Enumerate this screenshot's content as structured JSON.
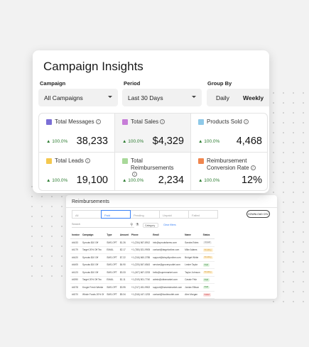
{
  "insights": {
    "title": "Campaign Insights",
    "campaign_label": "Campaign",
    "campaign_value": "All Campaigns",
    "period_label": "Period",
    "period_value": "Last 30 Days",
    "group_label": "Group By",
    "group_options": [
      "Daily",
      "Weekly"
    ],
    "group_selected": "Weekly",
    "metrics": [
      {
        "name": "Total Messages",
        "change": "▲ 100.0%",
        "value": "38,233",
        "color": "#7b6fd6"
      },
      {
        "name": "Total Sales",
        "change": "▲ 100.0%",
        "value": "$4,329",
        "color": "#c77dd8"
      },
      {
        "name": "Products Sold",
        "change": "▲ 100.0%",
        "value": "4,468",
        "color": "#8ec9e8"
      },
      {
        "name": "Total Leads",
        "change": "▲ 100.0%",
        "value": "19,100",
        "color": "#f4c84e"
      },
      {
        "name": "Total Reimbursements",
        "change": "▲ 100.0%",
        "value": "2,234",
        "color": "#a9d99a"
      },
      {
        "name": "Reimbursement Conversion Rate",
        "change": "▲ 100.0%",
        "value": "12%",
        "color": "#f0864e"
      }
    ]
  },
  "reimbursements": {
    "title": "Reimbursements",
    "filter_tabs": [
      "All",
      "Paid",
      "Pending",
      "Unpaid",
      "Failed"
    ],
    "active_tab": "Paid",
    "download_label": "DOWNLOAD CSV",
    "search_placeholder": "Search",
    "category_label": "Category",
    "clear_label": "Clear filters",
    "columns": [
      "Invoice",
      "Campaign",
      "Type",
      "Amount",
      "Phone",
      "Email",
      "Name",
      "Status"
    ],
    "rows": [
      [
        "#4433",
        "Sprouts $10 Off",
        "SMS-OPT",
        "$1.26",
        "+1 (234) 567-8912",
        "info@sproutsfarms.com",
        "Sandra Estes",
        "Unpaid"
      ],
      [
        "#4179",
        "Target 20% Off Tec",
        "EMAIL",
        "$2.17",
        "+1 (780) 521-9905",
        "contact@targetonline.com",
        "Mike Adams",
        "Pending"
      ],
      [
        "#4420",
        "Sprouts $10 Off",
        "SMS-OPT",
        "$7.22",
        "+1 (316) 660-2785",
        "support@shopifyonline.com",
        "Bridget White",
        "Pending"
      ],
      [
        "#4405",
        "Sprouts $10 Off",
        "SMS-OPT",
        "$4.90",
        "+1 (220) 847-6543",
        "service@groceryoutlet.com",
        "Lester Taylor",
        "Paid"
      ],
      [
        "#4123",
        "Sprouts $10 Off",
        "SMS-OPT",
        "$3.33",
        "+1 (407) 667-2233",
        "hello@supermarket.com",
        "Taylor Johnson",
        "Pending"
      ],
      [
        "#4390",
        "Target 20% Off Tec",
        "EMAIL",
        "$1.11",
        "+1 (919) 501-7740",
        "admin@ultramarket.com",
        "Cassie Fritz",
        "Paid"
      ],
      [
        "#4378",
        "Kroger Fresh Weeke",
        "SMS-OPT",
        "$3.95",
        "+1 (217) 451-9902",
        "support@harvestmarket.com",
        "Jordan Ellison",
        "Paid"
      ],
      [
        "#4370",
        "Whole Foods 20% Of",
        "SMS-OPT",
        "$5.34",
        "+1 (516) 447-1233",
        "contact@foodieoutlet.com",
        "Alex Morgan",
        "Failed"
      ]
    ],
    "status_colors": {
      "Unpaid": [
        "#eeeeee",
        "#777777"
      ],
      "Pending": [
        "#fff1d6",
        "#c98a10"
      ],
      "Paid": [
        "#dff3df",
        "#2e7d32"
      ],
      "Failed": [
        "#fbe0e0",
        "#c62828"
      ]
    }
  }
}
